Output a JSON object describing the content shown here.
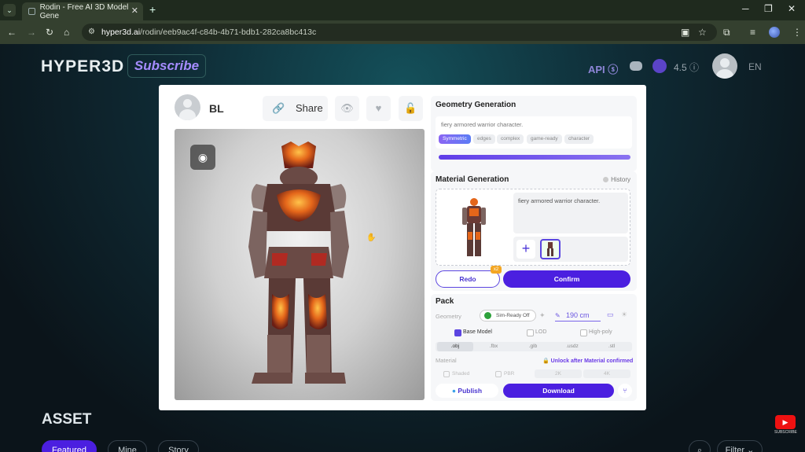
{
  "browser": {
    "tab_title": "Rodin - Free AI 3D Model Gene",
    "url_host": "hyper3d.ai",
    "url_path": "/rodin/eeb9ac4f-c84b-4b71-bdb1-282ca8bc413c"
  },
  "site": {
    "logo": "HYPER3D",
    "subscribe": "Subscribe",
    "api": "API",
    "credits": "4.5",
    "lang": "EN",
    "asset_heading": "ASSET",
    "tabs": [
      "Featured",
      "Mine",
      "Story"
    ],
    "filter": "Filter"
  },
  "viewer_header": {
    "username": "BL",
    "share_label": "Share"
  },
  "geometry": {
    "title": "Geometry Generation",
    "prompt": "fiery armored warrior character.",
    "chips": [
      "Symmetric",
      "edges",
      "complex",
      "game-ready",
      "character"
    ],
    "active_chip": "Symmetric",
    "progress": 1.0
  },
  "material": {
    "title": "Material Generation",
    "history": "History",
    "prompt": "fiery armored warrior character.",
    "redo": "Redo",
    "redo_badge": "x2",
    "confirm": "Confirm"
  },
  "pack": {
    "title": "Pack",
    "geometry_label": "Geometry",
    "sim_ready": "Sim-Ready Off",
    "height": "190",
    "height_unit": "cm",
    "options": [
      "Base Model",
      "LOD",
      "High-poly"
    ],
    "formats": [
      ".obj",
      ".fbx",
      ".glb",
      ".usdz",
      ".stl"
    ],
    "selected_format": ".obj",
    "material_label": "Material",
    "unlock_note": "Unlock after Material confirmed",
    "material_options": [
      "Shaded",
      "PBR"
    ],
    "resolutions": [
      "2K",
      "4K"
    ],
    "publish": "Publish",
    "download": "Download"
  },
  "overlay": {
    "youtube_label": "SUBSCRIBE"
  },
  "colors": {
    "accent": "#4b1fe0",
    "badge": "#f3a623"
  }
}
